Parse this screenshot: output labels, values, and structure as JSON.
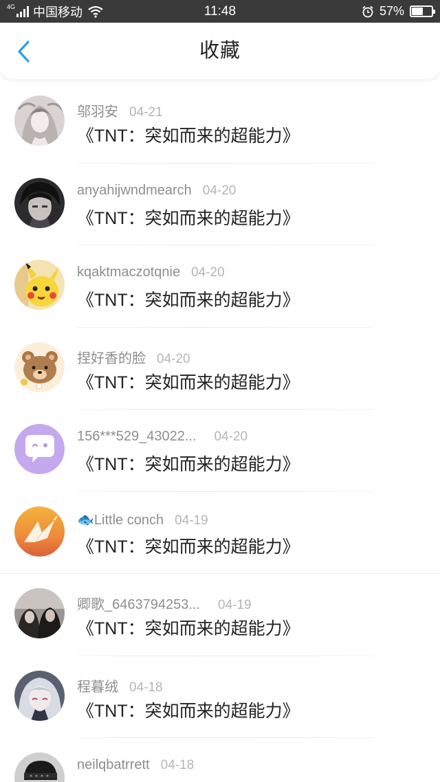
{
  "status_bar": {
    "network": "4G",
    "carrier": "中国移动",
    "time": "11:48",
    "battery": "57%",
    "battery_level": 0.57
  },
  "header": {
    "title": "收藏",
    "back_icon": "chevron-left-icon",
    "accent_color": "#2b9bf0"
  },
  "favorites": [
    {
      "user": "邬羽安",
      "date": "04-21",
      "title": "《TNT：突如而来的超能力》"
    },
    {
      "user": "anyahijwndmearch",
      "date": "04-20",
      "title": "《TNT：突如而来的超能力》"
    },
    {
      "user": "kqaktmaczotqnie",
      "date": "04-20",
      "title": "《TNT：突如而来的超能力》"
    },
    {
      "user": "捏好香的脸",
      "date": "04-20",
      "title": "《TNT：突如而来的超能力》"
    },
    {
      "user": "156***529_43022...",
      "date": "04-20",
      "title": "《TNT：突如而来的超能力》"
    },
    {
      "user": "🐟Little conch",
      "date": "04-19",
      "title": "《TNT：突如而来的超能力》"
    },
    {
      "user": "卿歌_6463794253...",
      "date": "04-19",
      "title": "《TNT：突如而来的超能力》"
    },
    {
      "user": "程暮绒",
      "date": "04-18",
      "title": "《TNT：突如而来的超能力》"
    },
    {
      "user": "neilqbatrrett",
      "date": "04-18",
      "title": ""
    }
  ]
}
